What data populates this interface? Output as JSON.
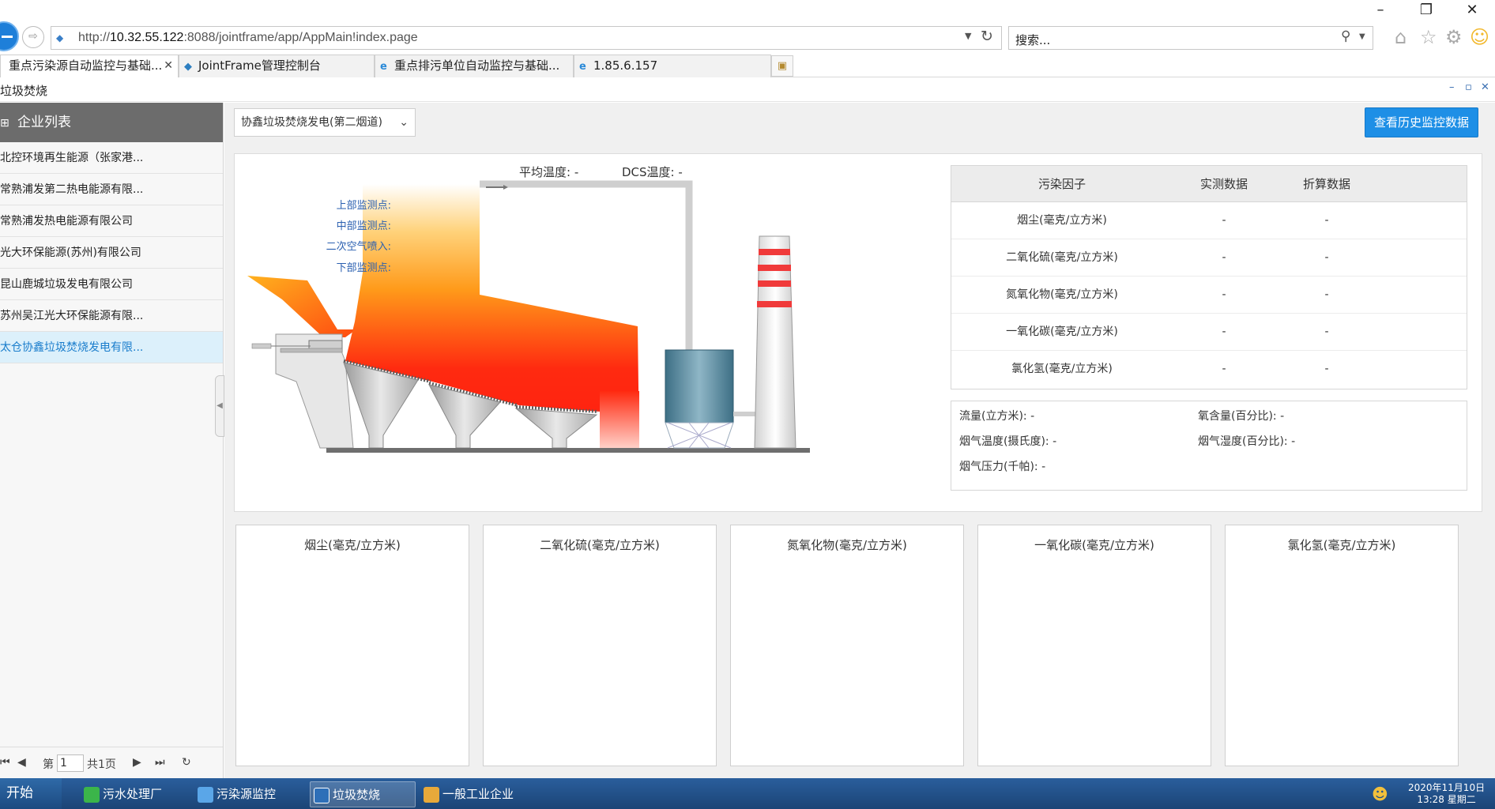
{
  "browser": {
    "url_prefix": "http://",
    "url_host": "10.32.55.122",
    "url_rest": ":8088/jointframe/app/AppMain!index.page",
    "search_placeholder": "搜索...",
    "tabs": [
      {
        "label": "重点污染源自动监控与基础...",
        "active": true
      },
      {
        "label": "JointFrame管理控制台",
        "active": false
      },
      {
        "label": "重点排污单位自动监控与基础...",
        "active": false
      },
      {
        "label": "1.85.6.157",
        "active": false
      }
    ]
  },
  "app": {
    "title": "垃圾焚烧"
  },
  "sidebar": {
    "header": "企业列表",
    "items": [
      {
        "label": "北控环境再生能源（张家港...",
        "active": false
      },
      {
        "label": "常熟浦发第二热电能源有限...",
        "active": false
      },
      {
        "label": "常熟浦发热电能源有限公司",
        "active": false
      },
      {
        "label": "光大环保能源(苏州)有限公司",
        "active": false
      },
      {
        "label": "昆山鹿城垃圾发电有限公司",
        "active": false
      },
      {
        "label": "苏州吴江光大环保能源有限...",
        "active": false
      },
      {
        "label": "太仓协鑫垃圾焚烧发电有限...",
        "active": true
      }
    ],
    "pager": {
      "page_label": "第",
      "page_value": "1",
      "total_label": "共1页"
    }
  },
  "main": {
    "selected_plant": "协鑫垃圾焚烧发电(第二烟道)",
    "history_button": "查看历史监控数据",
    "avg_temp": "平均温度:  -",
    "dcs_temp": "DCS温度:  -",
    "monitor_points": [
      "上部监测点:",
      "中部监测点:",
      "二次空气喷入:",
      "下部监测点:"
    ],
    "factor_table": {
      "headers": [
        "污染因子",
        "实测数据",
        "折算数据"
      ],
      "rows": [
        {
          "name": "烟尘(毫克/立方米)",
          "measured": "-",
          "converted": "-"
        },
        {
          "name": "二氧化硫(毫克/立方米)",
          "measured": "-",
          "converted": "-"
        },
        {
          "name": "氮氧化物(毫克/立方米)",
          "measured": "-",
          "converted": "-"
        },
        {
          "name": "一氧化碳(毫克/立方米)",
          "measured": "-",
          "converted": "-"
        },
        {
          "name": "氯化氢(毫克/立方米)",
          "measured": "-",
          "converted": "-"
        }
      ]
    },
    "flow": {
      "flow": "流量(立方米):  -",
      "oxygen": "氧含量(百分比):  -",
      "gas_temp": "烟气温度(摄氏度):  -",
      "gas_humidity": "烟气湿度(百分比):  -",
      "gas_pressure": "烟气压力(千帕):  -"
    },
    "chart_titles": [
      "烟尘(毫克/立方米)",
      "二氧化硫(毫克/立方米)",
      "氮氧化物(毫克/立方米)",
      "一氧化碳(毫克/立方米)",
      "氯化氢(毫克/立方米)"
    ]
  },
  "taskbar": {
    "start": "开始",
    "tasks": [
      {
        "label": "污水处理厂",
        "active": false
      },
      {
        "label": "污染源监控",
        "active": false
      },
      {
        "label": "垃圾焚烧",
        "active": true
      },
      {
        "label": "一般工业企业",
        "active": false
      }
    ],
    "date": "2020年11月10日",
    "time": "13:28 星期二"
  },
  "colors": {
    "accent": "#1e8fe6",
    "sidebar_header": "#6c6c6c",
    "active_item": "#dcf0fb",
    "link_blue": "#2a5fb0",
    "chimney_stripe": "#f03a3a"
  }
}
